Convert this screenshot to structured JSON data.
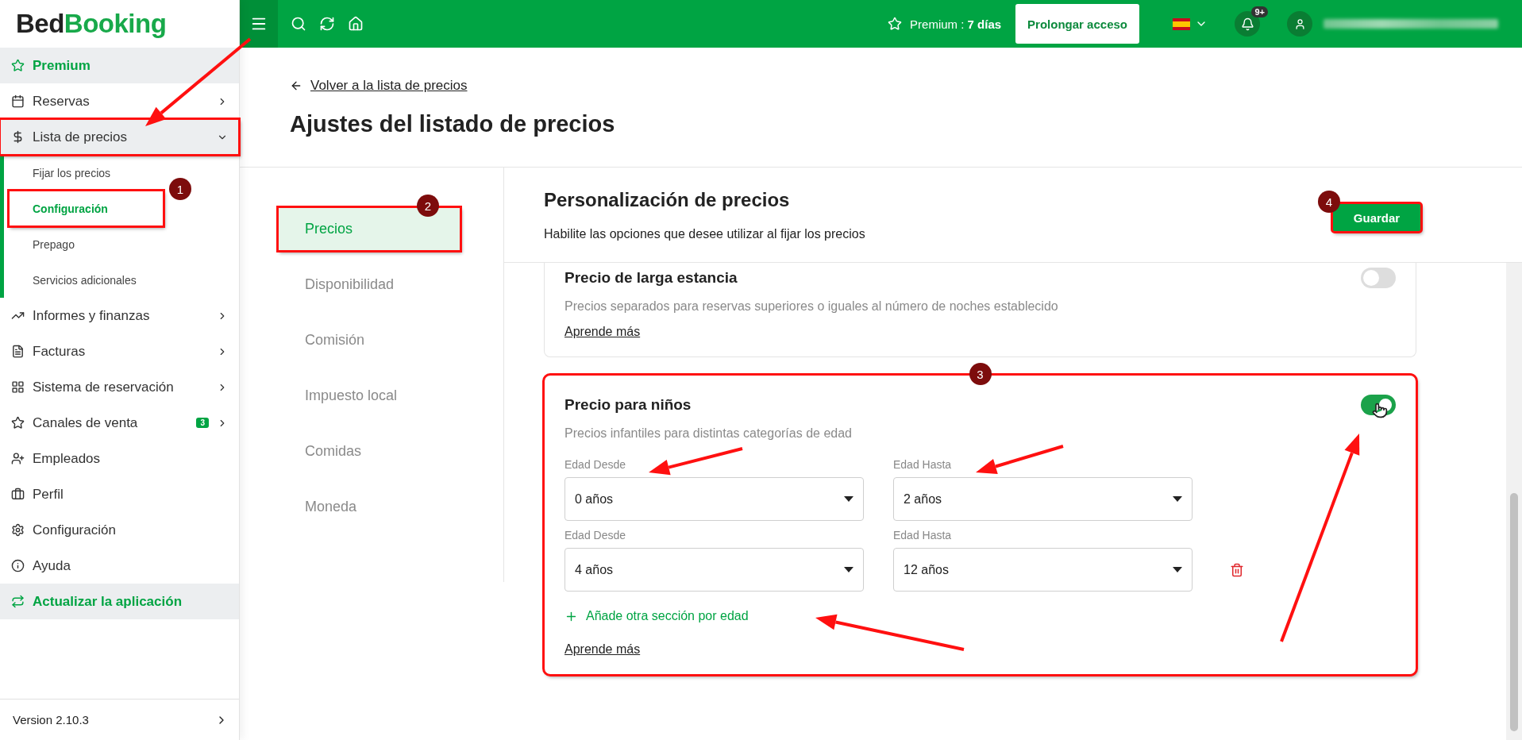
{
  "logo": {
    "first": "Bed",
    "second": "Booking"
  },
  "topbar": {
    "premium": "Premium : **7 días**",
    "extend_button": "Prolongar acceso",
    "notifications_count": "9+"
  },
  "sidebar": {
    "items": [
      {
        "kind": "premium",
        "label": "Premium"
      },
      {
        "kind": "nav",
        "label": "Reservas"
      },
      {
        "kind": "group",
        "label": "Lista de precios",
        "expanded": true,
        "highlighted": true,
        "children": [
          {
            "label": "Fijar los precios",
            "selected": false
          },
          {
            "label": "Configuración",
            "selected": true,
            "highlighted": true,
            "callout": "1"
          },
          {
            "label": "Prepago",
            "selected": false
          },
          {
            "label": "Servicios adicionales",
            "selected": false
          }
        ]
      },
      {
        "kind": "nav",
        "label": "Informes y finanzas"
      },
      {
        "kind": "nav",
        "label": "Facturas"
      },
      {
        "kind": "nav",
        "label": "Sistema de reservación"
      },
      {
        "kind": "nav",
        "label": "Canales de venta",
        "badge": "3"
      },
      {
        "kind": "plain",
        "label": "Empleados"
      },
      {
        "kind": "plain",
        "label": "Perfil"
      },
      {
        "kind": "plain",
        "label": "Configuración"
      },
      {
        "kind": "plain",
        "label": "Ayuda"
      },
      {
        "kind": "update",
        "label": "Actualizar la aplicación"
      }
    ],
    "version": "Version 2.10.3"
  },
  "main": {
    "back_link": "Volver a la lista de precios",
    "title": "Ajustes del listado de precios",
    "tabs": [
      {
        "label": "Precios",
        "selected": true,
        "highlighted": true,
        "callout": "2"
      },
      {
        "label": "Disponibilidad",
        "selected": false
      },
      {
        "label": "Comisión",
        "selected": false
      },
      {
        "label": "Impuesto local",
        "selected": false
      },
      {
        "label": "Comidas",
        "selected": false
      },
      {
        "label": "Moneda",
        "selected": false
      }
    ],
    "section": {
      "title": "Personalización de precios",
      "subtitle": "Habilite las opciones que desee utilizar al fijar los precios",
      "save_button": {
        "label": "Guardar",
        "highlighted": true,
        "callout": "4"
      }
    },
    "cards": [
      {
        "title": "Precio de larga estancia",
        "description": "Precios separados para reservas superiores o iguales al número de noches establecido",
        "on": false,
        "learn_more": "Aprende más"
      },
      {
        "title": "Precio para niños",
        "description": "Precios infantiles para distintas categorías de edad",
        "on": true,
        "highlighted": true,
        "callout": "3",
        "age_ranges": [
          {
            "from_label": "Edad Desde",
            "from": "0 años",
            "to_label": "Edad Hasta",
            "to": "2 años",
            "deletable": false
          },
          {
            "from_label": "Edad Desde",
            "from": "4 años",
            "to_label": "Edad Hasta",
            "to": "12 años",
            "deletable": true
          }
        ],
        "add_label": "Añade otra sección por edad",
        "learn_more": "Aprende más"
      }
    ]
  }
}
